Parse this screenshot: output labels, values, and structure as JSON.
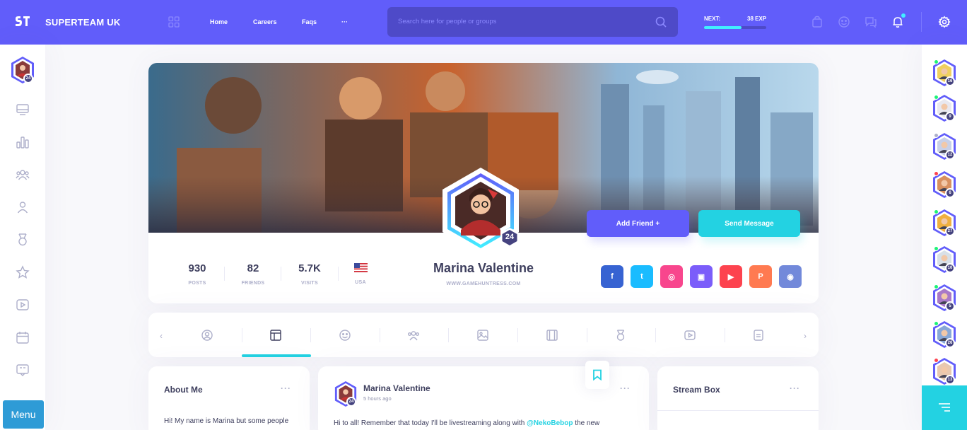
{
  "topbar": {
    "brand": "SUPERTEAM UK",
    "nav": [
      "Home",
      "Careers",
      "Faqs",
      "···"
    ],
    "search_placeholder": "Search here for people or groups",
    "next_label": "NEXT:",
    "exp_label": "38 EXP",
    "exp_progress": 0.6
  },
  "left_sidebar": {
    "avatar_level": "24",
    "icons": [
      "newsfeed-icon",
      "overview-icon",
      "groups-icon",
      "members-icon",
      "badges-icon",
      "quests-icon",
      "streams-icon",
      "events-icon",
      "forums-icon"
    ],
    "menu_label": "Menu"
  },
  "right_sidebar": {
    "friends": [
      {
        "level": "16",
        "status": "#1df377"
      },
      {
        "level": "9",
        "status": "#1df377"
      },
      {
        "level": "12",
        "status": "#adafca"
      },
      {
        "level": "6",
        "status": "#fd434f"
      },
      {
        "level": "27",
        "status": "#1df377"
      },
      {
        "level": "10",
        "status": "#1df377"
      },
      {
        "level": "5",
        "status": "#1df377"
      },
      {
        "level": "26",
        "status": "#1df377"
      },
      {
        "level": "13",
        "status": "#fd434f"
      }
    ]
  },
  "profile": {
    "name": "Marina Valentine",
    "url": "WWW.GAMEHUNTRESS.COM",
    "level": "24",
    "stats": [
      {
        "value": "930",
        "label": "POSTS"
      },
      {
        "value": "82",
        "label": "FRIENDS"
      },
      {
        "value": "5.7K",
        "label": "VISITS"
      }
    ],
    "country": "USA",
    "add_friend": "Add Friend +",
    "send_message": "Send Message",
    "socials": [
      {
        "name": "facebook",
        "color": "#3763d2",
        "glyph": "f"
      },
      {
        "name": "twitter",
        "color": "#1abcff",
        "glyph": "t"
      },
      {
        "name": "instagram",
        "color": "#f8468d",
        "glyph": "◎"
      },
      {
        "name": "twitch",
        "color": "#7b5dfa",
        "glyph": "▣"
      },
      {
        "name": "youtube",
        "color": "#fd434f",
        "glyph": "▶"
      },
      {
        "name": "patreon",
        "color": "#ff7a51",
        "glyph": "P"
      },
      {
        "name": "discord",
        "color": "#7289da",
        "glyph": "◉"
      }
    ]
  },
  "tabs": [
    "about-tab",
    "timeline-tab",
    "friends-tab",
    "groups-tab",
    "photos-tab",
    "videos-tab",
    "badges-tab",
    "streams-tab",
    "blog-tab"
  ],
  "about": {
    "title": "About Me",
    "text": "Hi! My name is Marina but some people"
  },
  "post": {
    "author": "Marina Valentine",
    "time": "5 hours ago",
    "level": "24",
    "text_before": "Hi to all! Remember that today I'll be livestreaming along with ",
    "mention": "@NekoBebop",
    "text_after": " the new"
  },
  "stream": {
    "title": "Stream Box"
  },
  "menu_dots": "···"
}
